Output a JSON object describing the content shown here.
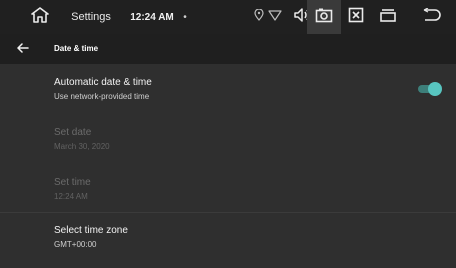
{
  "status_bar": {
    "app_name": "Settings",
    "time": "12:24 AM",
    "dot": "•",
    "icons": [
      "home-icon",
      "location-icon",
      "wifi-icon",
      "volume-icon",
      "screenshot-icon",
      "close-box-icon",
      "recents-icon",
      "back-icon"
    ]
  },
  "app_bar": {
    "title": "Date & time"
  },
  "items": [
    {
      "title": "Automatic date & time",
      "subtitle": "Use network-provided time",
      "enabled": true,
      "toggle": "on"
    },
    {
      "title": "Set date",
      "subtitle": "March 30, 2020",
      "enabled": false
    },
    {
      "title": "Set time",
      "subtitle": "12:24 AM",
      "enabled": false
    },
    {
      "title": "Select time zone",
      "subtitle": "GMT+00:00",
      "enabled": true
    }
  ],
  "colors": {
    "background": "#2f2f2f",
    "status_bar": "#202020",
    "app_bar": "#1f1f1f",
    "accent": "#58c5c0"
  }
}
